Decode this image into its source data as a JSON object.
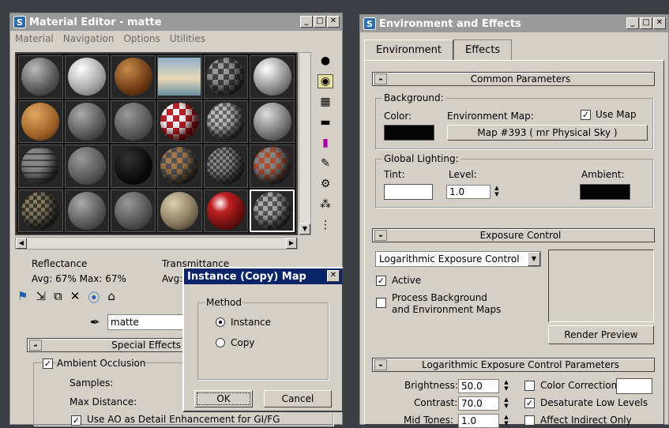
{
  "material_editor": {
    "title": "Material Editor - matte",
    "menu": [
      "Material",
      "Navigation",
      "Options",
      "Utilities"
    ],
    "reflectance_label": "Reflectance",
    "reflectance_avg": "Avg:  67% Max:  67%",
    "transmittance_label": "Transmittance",
    "transmittance_avg": "Avg:",
    "material_name": "matte",
    "rollout_title": "Special Effects",
    "ambient_occlusion_label": "Ambient Occlusion",
    "samples_label": "Samples:",
    "max_distance_label": "Max Distance:",
    "use_ao_label": "Use AO as Detail Enhancement for GI/FG"
  },
  "dialog": {
    "title": "Instance (Copy) Map",
    "group_label": "Method",
    "instance_label": "Instance",
    "copy_label": "Copy",
    "ok_label": "OK",
    "cancel_label": "Cancel"
  },
  "environment": {
    "title": "Environment and Effects",
    "tabs": [
      "Environment",
      "Effects"
    ],
    "common_params": "Common Parameters",
    "background_label": "Background:",
    "color_label": "Color:",
    "env_map_label": "Environment Map:",
    "use_map_label": "Use Map",
    "map_button": "Map #393  ( mr Physical Sky )",
    "global_lighting_label": "Global Lighting:",
    "tint_label": "Tint:",
    "level_label": "Level:",
    "level_value": "1.0",
    "ambient_label": "Ambient:",
    "exposure_control": "Exposure Control",
    "exposure_type": "Logarithmic Exposure Control",
    "active_label": "Active",
    "process_bg_label": "Process Background\nand Environment Maps",
    "render_preview": "Render Preview",
    "log_params": "Logarithmic Exposure Control Parameters",
    "brightness_label": "Brightness:",
    "brightness_value": "50.0",
    "contrast_label": "Contrast:",
    "contrast_value": "70.0",
    "midtones_label": "Mid Tones:",
    "midtones_value": "1.0",
    "color_correction_label": "Color Correction:",
    "desaturate_label": "Desaturate Low Levels",
    "affect_indirect_label": "Affect Indirect Only"
  },
  "colors": {
    "background_swatch": "#050505",
    "tint_swatch": "#ffffff",
    "ambient_swatch": "#050505",
    "color_correction_swatch": "#ffffff"
  }
}
